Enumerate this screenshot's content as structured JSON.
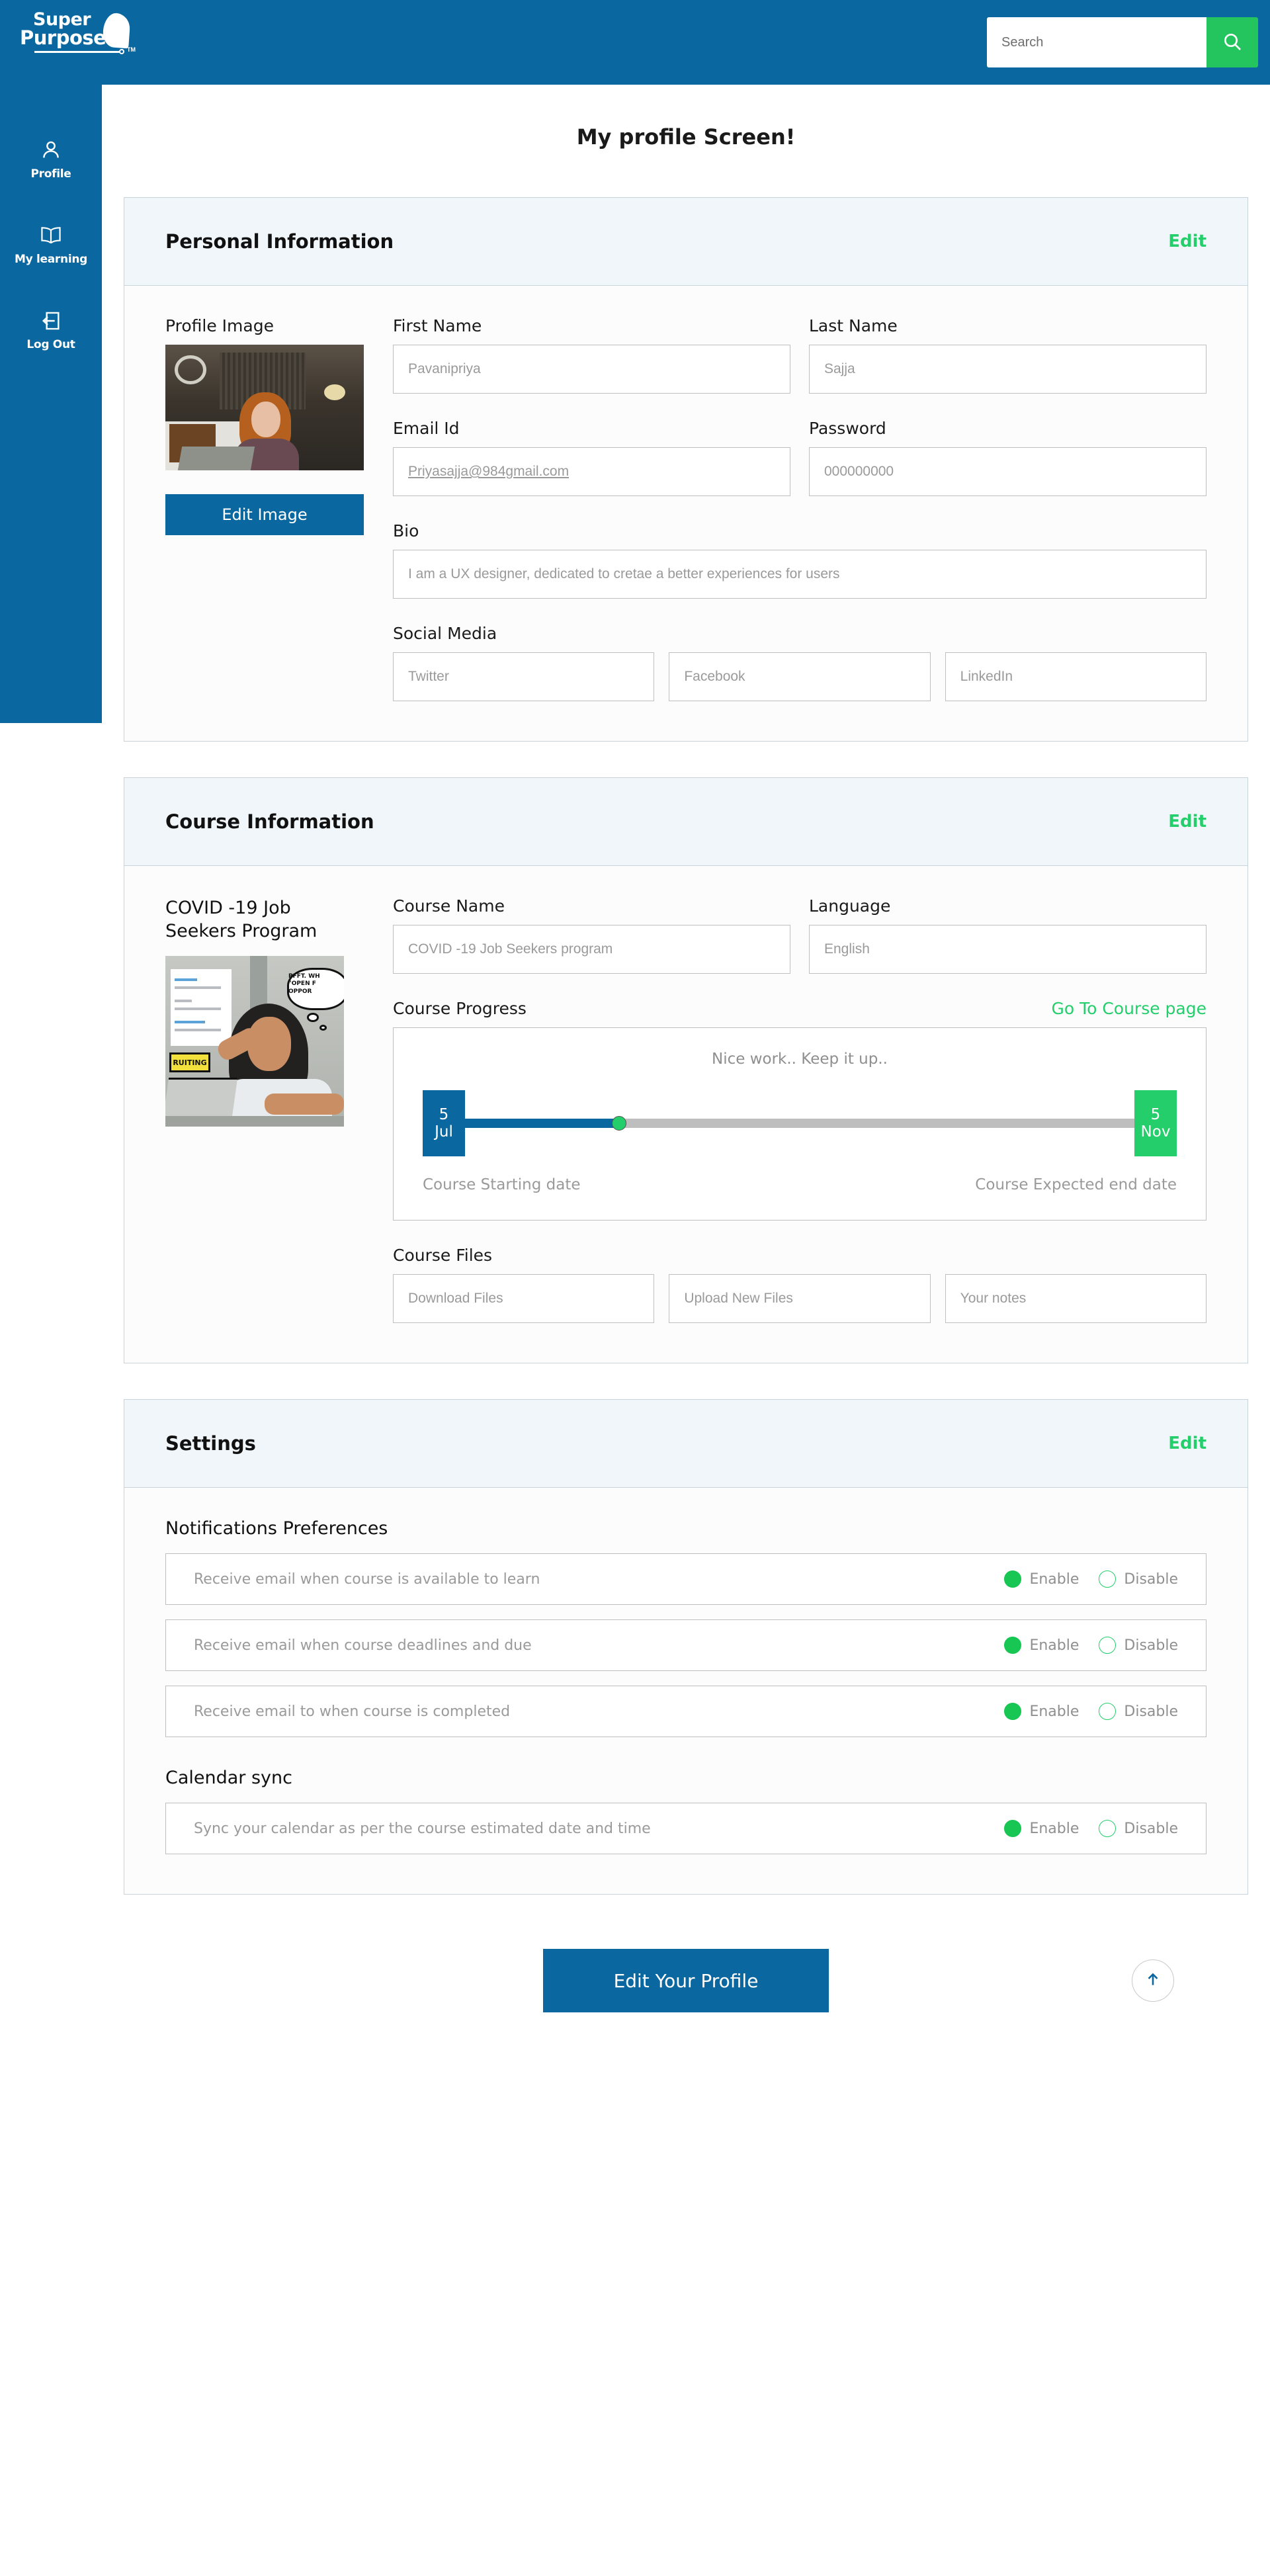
{
  "header": {
    "logo": {
      "line1": "Super",
      "line2": "Purposes",
      "trademark": "TM"
    },
    "search": {
      "placeholder": "Search",
      "value": "",
      "icon": "search-icon"
    }
  },
  "sidebar": {
    "items": [
      {
        "label": "Profile",
        "icon": "user-icon"
      },
      {
        "label": "My learning",
        "icon": "book-icon"
      },
      {
        "label": "Log Out",
        "icon": "logout-icon"
      }
    ]
  },
  "page": {
    "title": "My profile Screen!"
  },
  "personal_information": {
    "section_title": "Personal Information",
    "edit_label": "Edit",
    "profile_image_label": "Profile Image",
    "edit_image_button": "Edit Image",
    "first_name": {
      "label": "First Name",
      "placeholder": "Pavanipriya",
      "value": ""
    },
    "last_name": {
      "label": "Last Name",
      "placeholder": "Sajja",
      "value": ""
    },
    "email": {
      "label": "Email Id",
      "placeholder": "Priyasajja@984gmail.com",
      "value": ""
    },
    "password": {
      "label": "Password",
      "placeholder": "000000000",
      "value": ""
    },
    "bio": {
      "label": "Bio",
      "placeholder": "I am a UX designer, dedicated to cretae a better experiences for users",
      "value": ""
    },
    "social_media": {
      "label": "Social Media",
      "fields": [
        {
          "placeholder": "Twitter",
          "value": ""
        },
        {
          "placeholder": "Facebook",
          "value": ""
        },
        {
          "placeholder": "LinkedIn",
          "value": ""
        }
      ]
    }
  },
  "course_information": {
    "section_title": "Course Information",
    "edit_label": "Edit",
    "course_heading": "COVID -19 Job Seekers Program",
    "thumbnail_caption": "RUITING",
    "thumbnail_bubble": "PFFT. WH \"OPEN F OPPOR",
    "course_name": {
      "label": "Course Name",
      "placeholder": "COVID -19 Job Seekers program",
      "value": ""
    },
    "language": {
      "label": "Language",
      "placeholder": "English",
      "value": ""
    },
    "progress": {
      "label": "Course Progress",
      "go_to_course_link": "Go To Course page",
      "message": "Nice work.. Keep it up..",
      "start": {
        "day": "5",
        "month": "Jul"
      },
      "end": {
        "day": "5",
        "month": "Nov"
      },
      "start_caption": "Course Starting date",
      "end_caption": "Course Expected end date",
      "percent": 23
    },
    "files": {
      "label": "Course Files",
      "fields": [
        {
          "placeholder": "Download Files",
          "value": ""
        },
        {
          "placeholder": "Upload New Files",
          "value": ""
        },
        {
          "placeholder": "Your notes",
          "value": ""
        }
      ]
    }
  },
  "settings": {
    "section_title": "Settings",
    "edit_label": "Edit",
    "notifications_title": "Notifications Preferences",
    "enable_label": "Enable",
    "disable_label": "Disable",
    "notifications": [
      {
        "text": "Receive email when course is available to learn",
        "selected": "enable"
      },
      {
        "text": "Receive email when course deadlines and due",
        "selected": "enable"
      },
      {
        "text": "Receive email to when course is completed",
        "selected": "enable"
      }
    ],
    "calendar_title": "Calendar sync",
    "calendar": {
      "text": "Sync your calendar as per the course estimated date and time",
      "selected": "enable"
    }
  },
  "footer": {
    "primary_button": "Edit Your Profile",
    "scroll_top_icon": "arrow-up-icon"
  },
  "colors": {
    "brand_blue": "#0A679F",
    "accent_green": "#23CE6B",
    "section_bg": "#F0F6FA"
  }
}
